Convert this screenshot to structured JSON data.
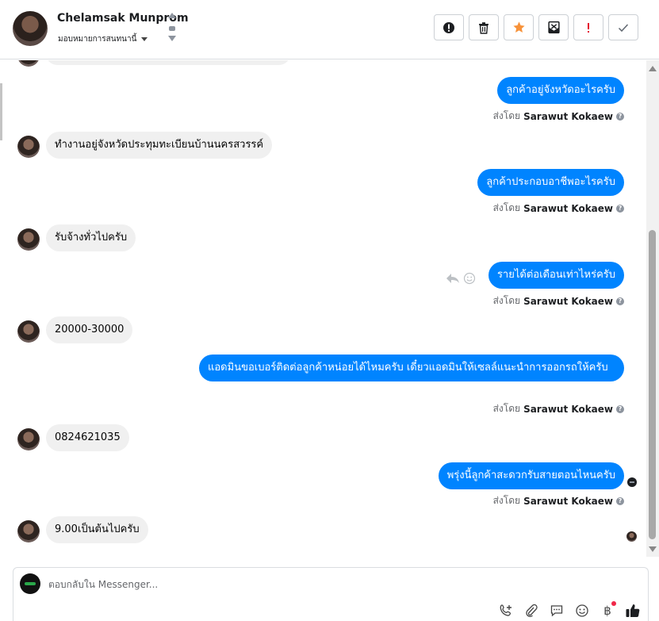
{
  "header": {
    "contact_name": "Chelamsak Munprom",
    "assign_label": "มอบหมายการสนทนานี้"
  },
  "toolbar": {
    "buttons": [
      {
        "name": "alert-icon",
        "label": "Spam"
      },
      {
        "name": "trash-icon",
        "label": "Delete"
      },
      {
        "name": "star-icon",
        "label": "Star"
      },
      {
        "name": "mark-unread-icon",
        "label": "Mark unread"
      },
      {
        "name": "exclamation-icon",
        "label": "Follow up"
      },
      {
        "name": "check-icon",
        "label": "Done"
      }
    ],
    "colors": {
      "star": "#f7923a",
      "follow_up": "#e4002b"
    }
  },
  "messages": [
    {
      "dir": "out",
      "text": "ลูกค้าอยู่จังหวัดอะไรครับ",
      "sent_by_prefix": "ส่งโดย",
      "sent_by": "Sarawut Kokaew"
    },
    {
      "dir": "in",
      "text": "ทำงานอยู่จังหวัดประทุมทะเบียนบ้านนครสวรรค์"
    },
    {
      "dir": "out",
      "text": "ลูกค้าประกอบอาชีพอะไรครับ",
      "sent_by_prefix": "ส่งโดย",
      "sent_by": "Sarawut Kokaew"
    },
    {
      "dir": "in",
      "text": "รับจ้างทั่วไปครับ"
    },
    {
      "dir": "out",
      "text": "รายได้ต่อเดือนเท่าไหร่ครับ",
      "sent_by_prefix": "ส่งโดย",
      "sent_by": "Sarawut Kokaew"
    },
    {
      "dir": "in",
      "text": "20000-30000"
    },
    {
      "dir": "out",
      "text": "แอดมินขอเบอร์ติดต่อลูกค้าหน่อยได้ไหมครับ เดี๋ยวแอดมินให้เซลล์แนะนำการออกรถให้ครับ",
      "sent_by_prefix": "ส่งโดย",
      "sent_by": "Sarawut Kokaew"
    },
    {
      "dir": "in",
      "text": "0824621035"
    },
    {
      "dir": "out",
      "text": "พรุ่งนี้ลูกค้าสะดวกรับสายตอนไหนครับ",
      "sent_by_prefix": "ส่งโดย",
      "sent_by": "Sarawut Kokaew"
    },
    {
      "dir": "in",
      "text": "9.00เป็นต้นไปครับ"
    }
  ],
  "composer": {
    "placeholder": "ตอบกลับใน Messenger...",
    "tools": [
      "call-add-icon",
      "attach-icon",
      "saved-reply-icon",
      "emoji-icon",
      "baht-icon",
      "like-icon"
    ],
    "baht_symbol": "฿"
  },
  "colors": {
    "outgoing_bubble": "#0084ff",
    "incoming_bubble": "#f0f0f0"
  }
}
